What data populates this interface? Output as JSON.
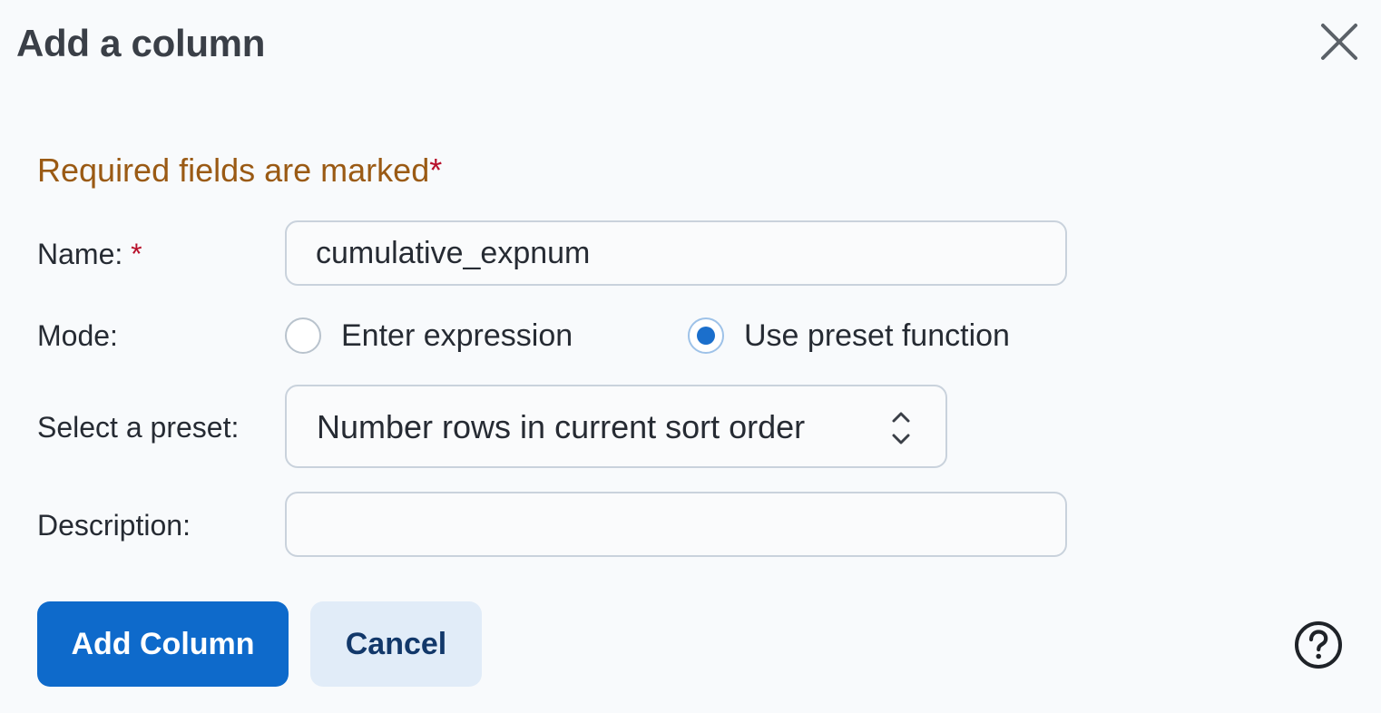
{
  "dialog": {
    "title": "Add a column",
    "close_icon": "close-icon",
    "required_note": "Required fields are marked",
    "required_marker": "*"
  },
  "form": {
    "name": {
      "label": "Name:",
      "required_marker": "*",
      "value": "cumulative_expnum"
    },
    "mode": {
      "label": "Mode:",
      "options": [
        {
          "label": "Enter expression",
          "checked": false
        },
        {
          "label": "Use preset function",
          "checked": true
        }
      ]
    },
    "preset": {
      "label": "Select a preset:",
      "selected": "Number rows in current sort order",
      "icon": "chevron-updown-icon"
    },
    "description": {
      "label": "Description:",
      "value": ""
    }
  },
  "actions": {
    "add_label": "Add Column",
    "cancel_label": "Cancel",
    "help_icon": "help-icon"
  },
  "colors": {
    "primary": "#0e6acb",
    "secondary_bg": "#e1ecf8",
    "required_note": "#9a5a14",
    "required_star": "#b8102b",
    "background": "#f8fafc"
  }
}
